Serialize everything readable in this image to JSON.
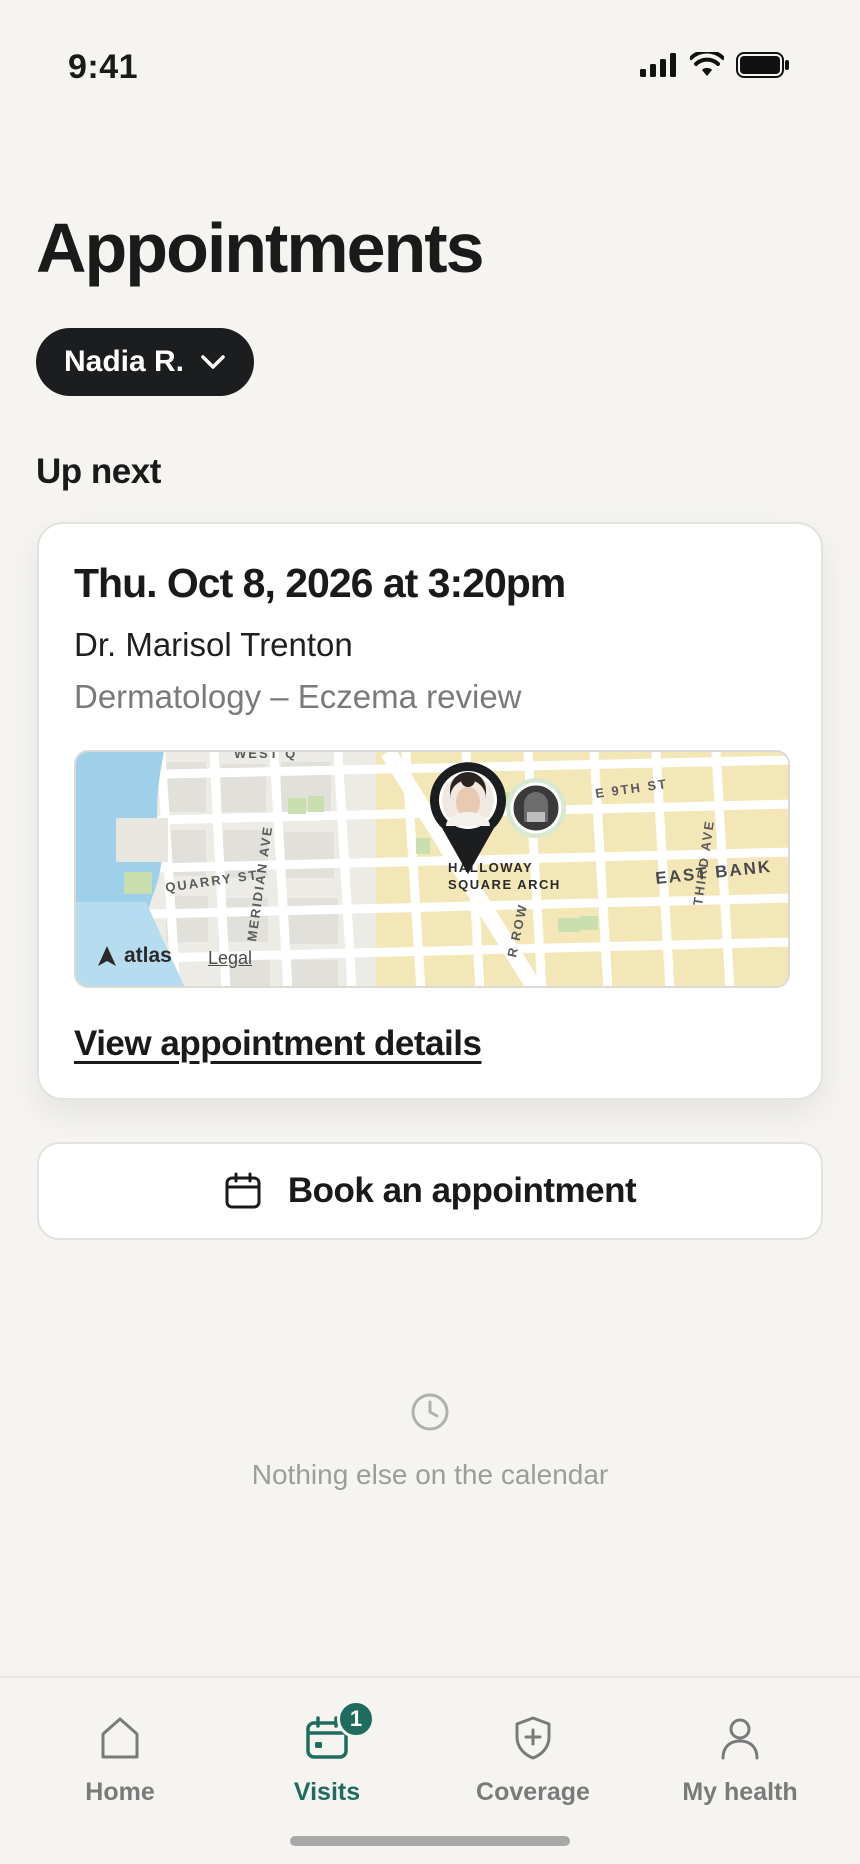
{
  "status_bar": {
    "time": "9:41"
  },
  "page": {
    "title": "Appointments"
  },
  "profile": {
    "name": "Nadia R."
  },
  "up_next": {
    "heading": "Up next",
    "date_time": "Thu. Oct 8, 2026 at 3:20pm",
    "doctor": "Dr. Marisol Trenton",
    "specialty": "Dermatology – Eczema review",
    "map": {
      "labels": {
        "west": "WEST Q",
        "e9th": "E 9TH ST",
        "quarry": "QUARRY ST",
        "meridian": "MERIDIAN AVE",
        "halloway_1": "HALLOWAY",
        "halloway_2": "SQUARE ARCH",
        "east_bank": "EAST BANK",
        "third_ave": "THIRD AVE",
        "row": "R ROW"
      },
      "provider_logo": "atlas",
      "legal": "Legal",
      "colors": {
        "water": "#9fd0ea",
        "block": "#f3e7b8",
        "park": "#c9dfb0",
        "street": "#ffffff"
      }
    },
    "details_link": "View appointment details"
  },
  "book": {
    "label": "Book an appointment",
    "icon": "calendar-icon"
  },
  "empty_state": {
    "text": "Nothing else on the calendar",
    "icon": "clock-icon"
  },
  "tabs": [
    {
      "label": "Home",
      "icon": "home-icon",
      "active": false
    },
    {
      "label": "Visits",
      "icon": "calendar-icon",
      "active": true,
      "badge": "1"
    },
    {
      "label": "Coverage",
      "icon": "shield-icon",
      "active": false
    },
    {
      "label": "My health",
      "icon": "person-icon",
      "active": false
    }
  ],
  "colors": {
    "accent": "#1f6b5e",
    "pill": "#1b1d1f",
    "background": "#f5f4f1"
  }
}
